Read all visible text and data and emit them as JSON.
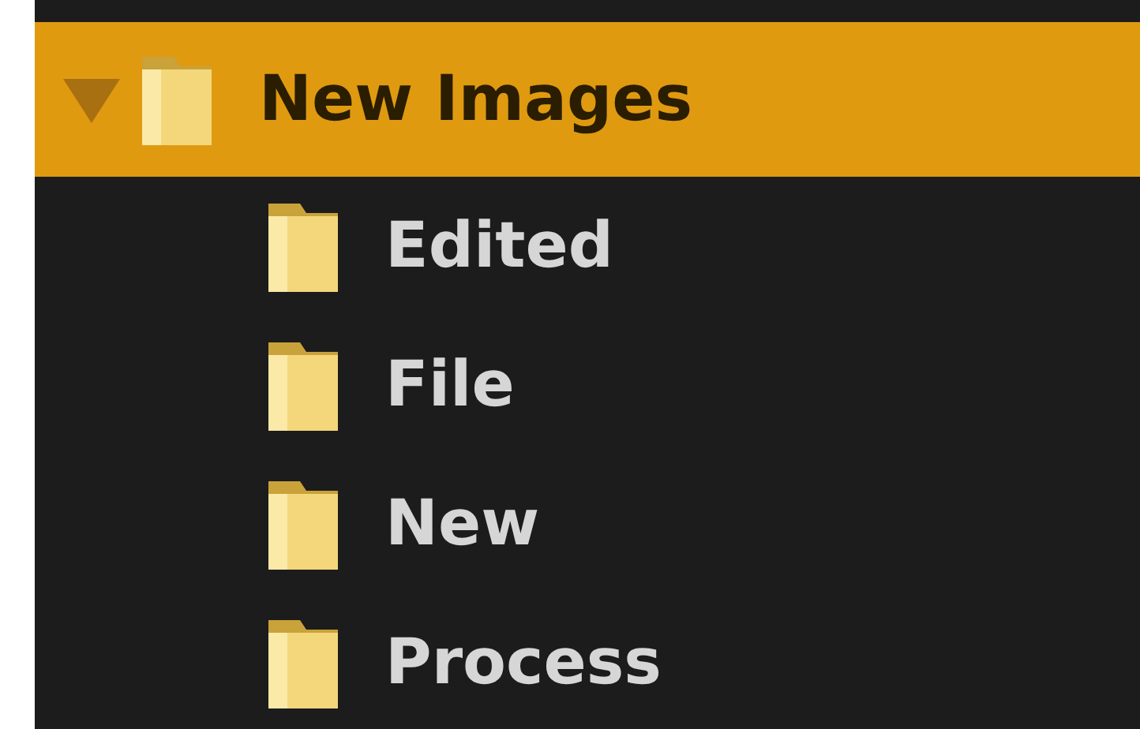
{
  "tree": [
    {
      "label": "New Images",
      "selected": true,
      "expanded": true,
      "children": [
        {
          "label": "Edited",
          "selected": false
        },
        {
          "label": "File",
          "selected": false
        },
        {
          "label": "New",
          "selected": false
        },
        {
          "label": "Process",
          "selected": false
        }
      ]
    }
  ]
}
